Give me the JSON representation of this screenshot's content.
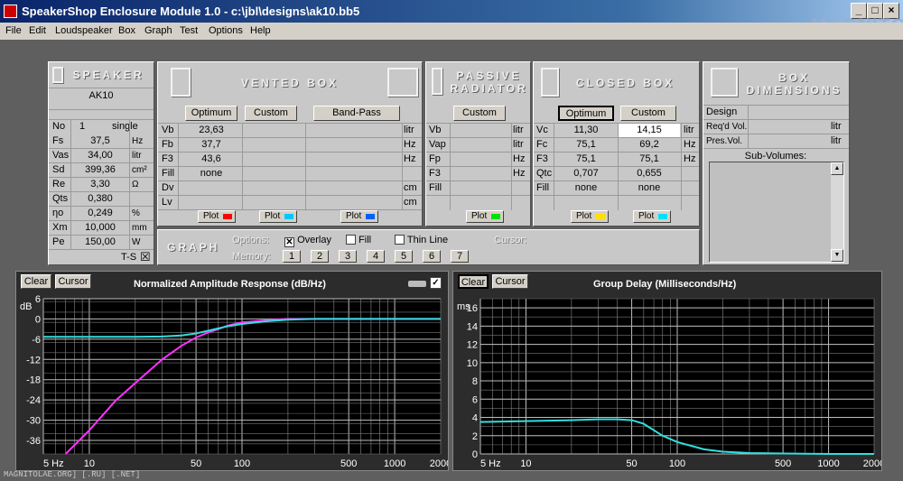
{
  "window": {
    "title": "SpeakerShop Enclosure Module 1.0 - c:\\jbl\\designs\\ak10.bb5",
    "min": "_",
    "max": "□",
    "close": "×",
    "watermark": "MAGNITOLA"
  },
  "footer": "MAGNITOLAE.ORG] [.RU] [.NET]",
  "menu": [
    "File",
    "Edit",
    "Loudspeaker",
    "Box",
    "Graph",
    "Test",
    "Options",
    "Help"
  ],
  "speaker": {
    "header": "SPEAKER",
    "model": "AK10",
    "no_label": "No",
    "no_value": "1",
    "mode": "single",
    "params": [
      {
        "name": "Fs",
        "value": "37,5",
        "unit": "Hz"
      },
      {
        "name": "Vas",
        "value": "34,00",
        "unit": "litr"
      },
      {
        "name": "Sd",
        "value": "399,36",
        "unit": "cm²"
      },
      {
        "name": "Re",
        "value": "3,30",
        "unit": "Ω"
      },
      {
        "name": "Qts",
        "value": "0,380",
        "unit": ""
      },
      {
        "name": "ηo",
        "value": "0,249",
        "unit": "%"
      },
      {
        "name": "Xm",
        "value": "10,000",
        "unit": "mm"
      },
      {
        "name": "Pe",
        "value": "150,00",
        "unit": "W"
      }
    ],
    "ts_label": "T-S",
    "ts_checked": "☒"
  },
  "vented": {
    "header": "VENTED BOX",
    "buttons": [
      "Optimum",
      "Custom",
      "Band-Pass"
    ],
    "rows": [
      {
        "label": "Vb",
        "v": [
          "23,63",
          "",
          ""
        ],
        "unit": "litr"
      },
      {
        "label": "Fb",
        "v": [
          "37,7",
          "",
          ""
        ],
        "unit": "Hz"
      },
      {
        "label": "F3",
        "v": [
          "43,6",
          "",
          ""
        ],
        "unit": "Hz"
      },
      {
        "label": "Fill",
        "v": [
          "none",
          "",
          ""
        ],
        "unit": ""
      },
      {
        "label": "Dv",
        "v": [
          "",
          "",
          ""
        ],
        "unit": "cm"
      },
      {
        "label": "Lv",
        "v": [
          "",
          "",
          ""
        ],
        "unit": "cm"
      }
    ],
    "plots": [
      {
        "label": "Plot",
        "color": "#ff0000"
      },
      {
        "label": "Plot",
        "color": "#00c8ff"
      },
      {
        "label": "Plot",
        "color": "#0060ff"
      }
    ]
  },
  "passive": {
    "header1": "PASSIVE",
    "header2": "RADIATOR",
    "button": "Custom",
    "rows": [
      {
        "label": "Vb",
        "unit": "litr"
      },
      {
        "label": "Vap",
        "unit": "litr"
      },
      {
        "label": "Fp",
        "unit": "Hz"
      },
      {
        "label": "F3",
        "unit": "Hz"
      },
      {
        "label": "Fill",
        "unit": ""
      }
    ],
    "plot": {
      "label": "Plot",
      "color": "#00e000"
    }
  },
  "closed": {
    "header": "CLOSED BOX",
    "buttons": [
      "Optimum",
      "Custom"
    ],
    "rows": [
      {
        "label": "Vc",
        "v": [
          "11,30",
          "14,15"
        ],
        "unit": "litr"
      },
      {
        "label": "Fc",
        "v": [
          "75,1",
          "69,2"
        ],
        "unit": "Hz"
      },
      {
        "label": "F3",
        "v": [
          "75,1",
          "75,1"
        ],
        "unit": "Hz"
      },
      {
        "label": "Qtc",
        "v": [
          "0,707",
          "0,655"
        ],
        "unit": ""
      },
      {
        "label": "Fill",
        "v": [
          "none",
          "none"
        ],
        "unit": ""
      }
    ],
    "plots": [
      {
        "label": "Plot",
        "color": "#ffe000"
      },
      {
        "label": "Plot",
        "color": "#00e0ff"
      }
    ]
  },
  "dims": {
    "header1": "BOX",
    "header2": "DIMENSIONS",
    "rows": [
      {
        "label": "Design",
        "unit": ""
      },
      {
        "label": "Req'd Vol.",
        "unit": "litr"
      },
      {
        "label": "Pres.Vol.",
        "unit": "litr"
      }
    ],
    "subvol": "Sub-Volumes:",
    "up": "▲",
    "down": "▼"
  },
  "graphbar": {
    "title": "GRAPH",
    "options_label": "Options:",
    "overlay": "Overlay",
    "fill": "Fill",
    "thin": "Thin Line",
    "cursor_label": "Cursor:",
    "memory_label": "Memory:",
    "memory": [
      "1",
      "2",
      "3",
      "4",
      "5",
      "6",
      "7"
    ],
    "check_on": "☒",
    "check_off": "☐"
  },
  "chart_data": [
    {
      "type": "line",
      "title": "Normalized Amplitude Response (dB/Hz)",
      "clear": "Clear",
      "cursor": "Cursor",
      "ylabel": "dB",
      "xscale": "log",
      "xlim": [
        5,
        2000
      ],
      "ylim": [
        -40,
        6
      ],
      "xticks": [
        5,
        10,
        50,
        100,
        500,
        1000,
        2000
      ],
      "xticklabels": [
        "5 Hz",
        "10",
        "50",
        "100",
        "500",
        "1000",
        "2000"
      ],
      "yticks": [
        6,
        0,
        -6,
        -12,
        -18,
        -24,
        -30,
        -36
      ],
      "yticklabels": [
        "6",
        "0",
        "-6",
        "-12",
        "-18",
        "-24",
        "-30",
        "-36"
      ],
      "grid": true,
      "series": [
        {
          "color": "#ff33ff",
          "x": [
            7,
            10,
            15,
            20,
            30,
            40,
            50,
            60,
            70,
            80,
            100,
            150,
            200,
            300,
            500,
            1000,
            2000
          ],
          "y": [
            -41,
            -33,
            -24,
            -19,
            -12,
            -8,
            -5.5,
            -4,
            -3,
            -2,
            -1,
            -0.3,
            0,
            0,
            0,
            0,
            0
          ]
        },
        {
          "color": "#33dddd",
          "x": [
            5,
            10,
            20,
            30,
            40,
            50,
            60,
            70,
            80,
            100,
            150,
            200,
            300,
            500,
            1000,
            2000
          ],
          "y": [
            -5.3,
            -5.3,
            -5.3,
            -5.2,
            -4.9,
            -4.3,
            -3.5,
            -2.8,
            -2.2,
            -1.5,
            -0.6,
            -0.2,
            0,
            0,
            0,
            0
          ]
        }
      ]
    },
    {
      "type": "line",
      "title": "Group Delay (Milliseconds/Hz)",
      "clear": "Clear",
      "cursor": "Cursor",
      "ylabel": "ms",
      "xscale": "log",
      "xlim": [
        5,
        2000
      ],
      "ylim": [
        0,
        17
      ],
      "xticks": [
        5,
        10,
        50,
        100,
        500,
        1000,
        2000
      ],
      "xticklabels": [
        "5 Hz",
        "10",
        "50",
        "100",
        "500",
        "1000",
        "2000"
      ],
      "yticks": [
        16,
        14,
        12,
        10,
        8,
        6,
        4,
        2,
        0
      ],
      "yticklabels": [
        "16",
        "14",
        "12",
        "10",
        "8",
        "6",
        "4",
        "2",
        "0"
      ],
      "grid": true,
      "series": [
        {
          "color": "#33dddd",
          "x": [
            5,
            10,
            20,
            30,
            40,
            50,
            60,
            70,
            80,
            100,
            150,
            200,
            300,
            500,
            1000,
            2000
          ],
          "y": [
            3.5,
            3.6,
            3.7,
            3.8,
            3.8,
            3.7,
            3.3,
            2.6,
            2.0,
            1.3,
            0.5,
            0.25,
            0.1,
            0.05,
            0,
            0
          ]
        }
      ]
    }
  ]
}
